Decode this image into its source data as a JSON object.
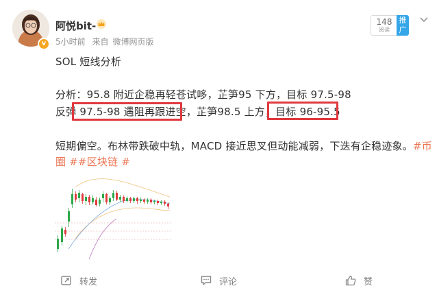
{
  "user": {
    "name": "阿悦bit-",
    "time": "5小时前",
    "source_prefix": "来自",
    "source": "微博网页版"
  },
  "header_right": {
    "read_count": "148",
    "read_label": "阅读",
    "promote_label": "推广"
  },
  "post": {
    "title": "SOL 短线分析",
    "line1": "分析：95.8 附近企稳再轻苍试哆，芷笋95 下方，目标 97.5-98",
    "line2": "反弹 97.5-98 遇阻再跟进空，芷笋98.5 上方，目标 96-95.5",
    "line3": "短期偏空。布林带跌破中轨，MACD 接近思叉但动能减弱，下迭有企稳迹象。",
    "hashtag1": "#币",
    "line4_hashtags": "圈 ##区块链 #"
  },
  "actions": {
    "repost": "转发",
    "comment": "评论",
    "like": "赞"
  },
  "colors": {
    "highlight": "#e0393e",
    "hashtag": "#eb7350",
    "candle_up": "#2ea84a",
    "candle_down": "#e03c3c"
  },
  "icons": [
    "crown-icon",
    "verified-badge-icon",
    "more-chevron-icon",
    "repost-icon",
    "comment-icon",
    "like-icon"
  ]
}
